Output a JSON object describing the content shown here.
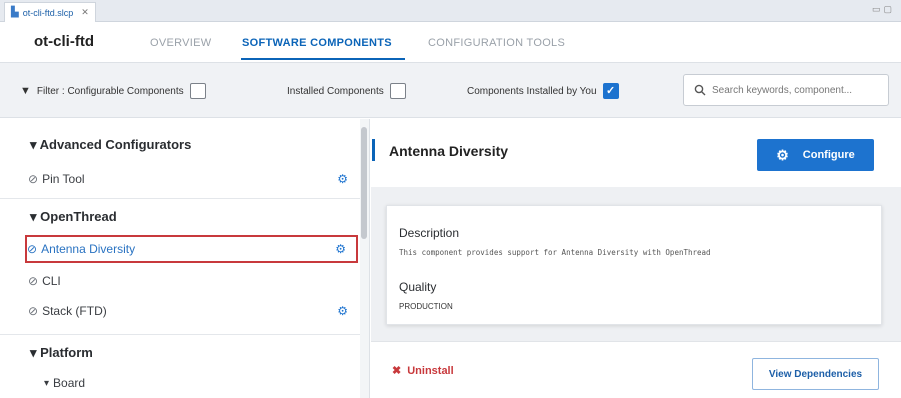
{
  "editor_tab": {
    "title": "ot-cli-ftd.slcp",
    "close": "✕"
  },
  "header": {
    "project_title": "ot-cli-ftd",
    "tabs": [
      {
        "label": "OVERVIEW",
        "active": false
      },
      {
        "label": "SOFTWARE COMPONENTS",
        "active": true
      },
      {
        "label": "CONFIGURATION TOOLS",
        "active": false
      }
    ]
  },
  "filters": {
    "configurable_label": "Filter : Configurable Components",
    "configurable_checked": false,
    "installed_label": "Installed Components",
    "installed_checked": false,
    "by_you_label": "Components Installed by You",
    "by_you_checked": true,
    "search_placeholder": "Search keywords, component..."
  },
  "tree": {
    "groups": [
      {
        "name": "Advanced Configurators",
        "items": [
          {
            "label": "Pin Tool",
            "icon": "gears-icon"
          }
        ]
      },
      {
        "name": "OpenThread",
        "items": [
          {
            "label": "Antenna Diversity",
            "icon": "gear-icon",
            "selected": true
          },
          {
            "label": "CLI"
          },
          {
            "label": "Stack (FTD)",
            "icon": "gear-icon"
          }
        ]
      },
      {
        "name": "Platform",
        "items": [
          {
            "label": "Board",
            "subgroup": true
          }
        ]
      }
    ]
  },
  "detail": {
    "title": "Antenna Diversity",
    "configure_label": "Configure",
    "description_label": "Description",
    "description_text": "This component provides support for Antenna Diversity with OpenThread",
    "quality_label": "Quality",
    "quality_value": "PRODUCTION",
    "uninstall_label": "Uninstall",
    "view_dependencies_label": "View Dependencies"
  },
  "colors": {
    "accent": "#1d73cf",
    "danger": "#c8393c"
  }
}
